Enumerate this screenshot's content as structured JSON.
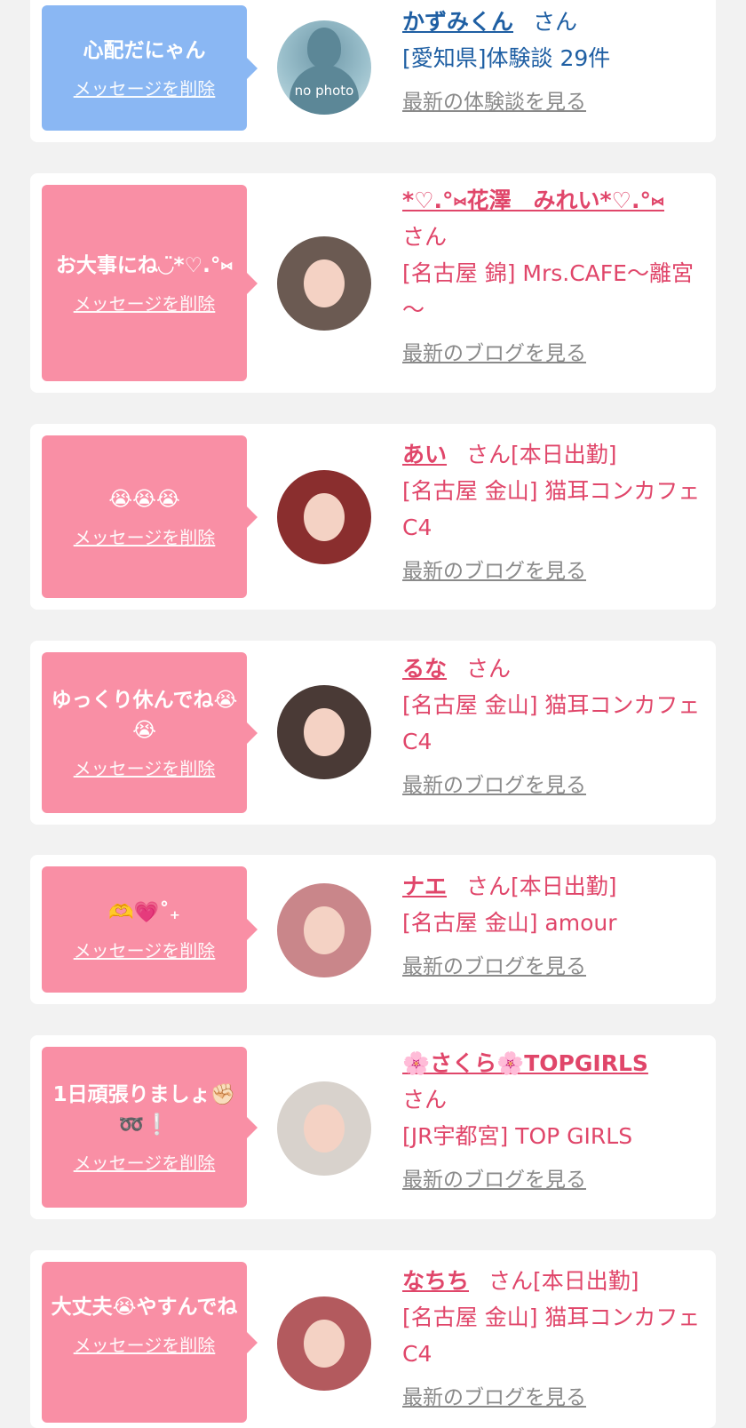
{
  "colors": {
    "page_bg": "#f2f2f2",
    "card_bg": "#ffffff",
    "blue_bubble": "#8ab7f3",
    "pink_bubble": "#f98fa5",
    "pink_text": "#e0466a",
    "blue_text": "#1f5fa3",
    "link_gray": "#8a8a8a"
  },
  "items": [
    {
      "message": "心配だにゃん",
      "delete_label": "メッセージを削除",
      "avatar_label": "no photo",
      "name": "かずみくん",
      "san": "さん",
      "status": "",
      "shop": "[愛知県]体験談 29件",
      "more_label": "最新の体験談を見る"
    },
    {
      "message": "お大事にね◡̈*♡.°⑅",
      "delete_label": "メッセージを削除",
      "name": "*♡.°⑅花澤　みれい*♡.°⑅",
      "san": "さん",
      "status": "",
      "shop": "[名古屋 錦] Mrs.CAFE～離宮～",
      "more_label": "最新のブログを見る"
    },
    {
      "message": "😭😭😭",
      "delete_label": "メッセージを削除",
      "name": "あい",
      "san": "さん",
      "status": "[本日出勤]",
      "shop": "[名古屋 金山] 猫耳コンカフェ C4",
      "more_label": "最新のブログを見る"
    },
    {
      "message": "ゆっくり休んでね😭😭",
      "delete_label": "メッセージを削除",
      "name": "るな",
      "san": "さん",
      "status": "",
      "shop": "[名古屋 金山] 猫耳コンカフェ C4",
      "more_label": "最新のブログを見る"
    },
    {
      "message": "🫶💗˚₊",
      "delete_label": "メッセージを削除",
      "name": "ナエ",
      "san": "さん",
      "status": "[本日出勤]",
      "shop": "[名古屋 金山] amour",
      "more_label": "最新のブログを見る"
    },
    {
      "message": "1日頑張りましょ✊🏻➿❕",
      "delete_label": "メッセージを削除",
      "name": "🌸さくら🌸TOPGIRLS",
      "san": "さん",
      "status": "",
      "shop": "[JR宇都宮] TOP GIRLS",
      "more_label": "最新のブログを見る"
    },
    {
      "message": "大丈夫😭やすんでね",
      "delete_label": "メッセージを削除",
      "name": "なちち",
      "san": "さん",
      "status": "[本日出勤]",
      "shop": "[名古屋 金山] 猫耳コンカフェ C4",
      "more_label": "最新のブログを見る"
    }
  ]
}
